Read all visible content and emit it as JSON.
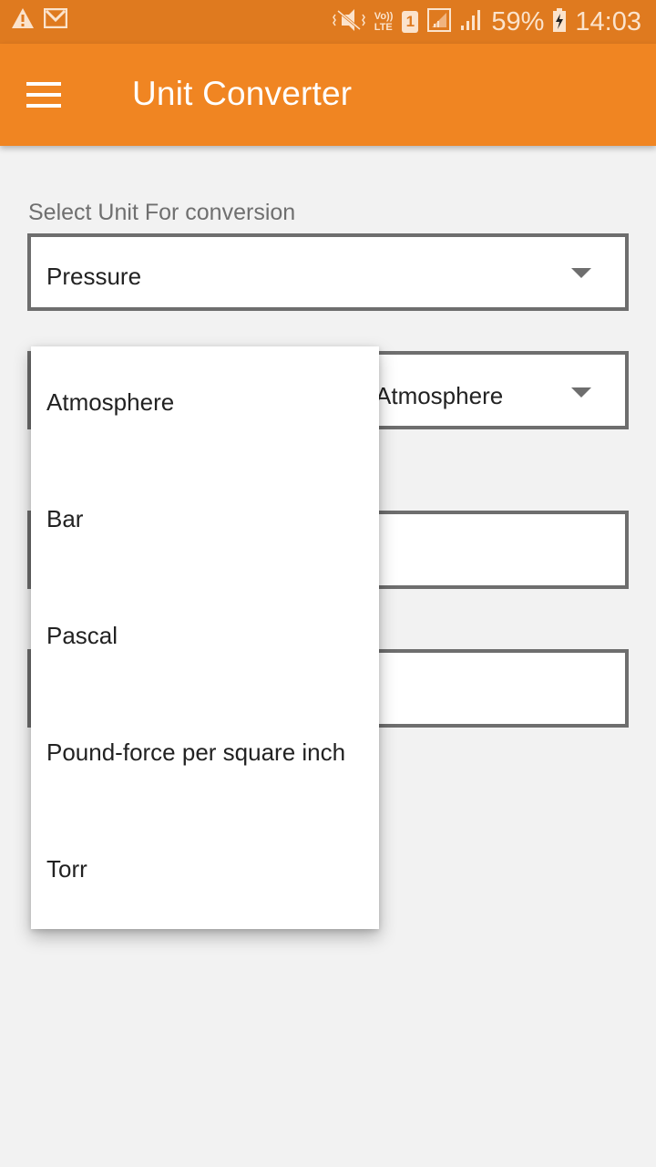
{
  "status_bar": {
    "left_icons": [
      "warning-icon",
      "gmail-icon"
    ],
    "right_icons": [
      "vibrate-mute-icon",
      "volte-icon",
      "sim1-icon",
      "signal-sim1-icon",
      "signal-sim2-icon"
    ],
    "volte_top": "Vo))",
    "volte_bottom": "LTE",
    "sim_label": "1",
    "battery_percent": "59%",
    "battery_icon": "battery-charging-icon",
    "time": "14:03"
  },
  "app_bar": {
    "menu_icon": "hamburger-menu-icon",
    "title": "Unit Converter",
    "color": "#f08522"
  },
  "form": {
    "category_label": "Select Unit For conversion",
    "category_value": "Pressure",
    "from_unit_value": "Atmosphere",
    "to_unit_value": "Atmosphere",
    "input_label_hidden": "",
    "input_value": "",
    "output_label_hidden": "",
    "output_value": ""
  },
  "dropdown": {
    "options": [
      "Atmosphere",
      "Bar",
      "Pascal",
      "Pound-force per square inch",
      "Torr"
    ]
  }
}
